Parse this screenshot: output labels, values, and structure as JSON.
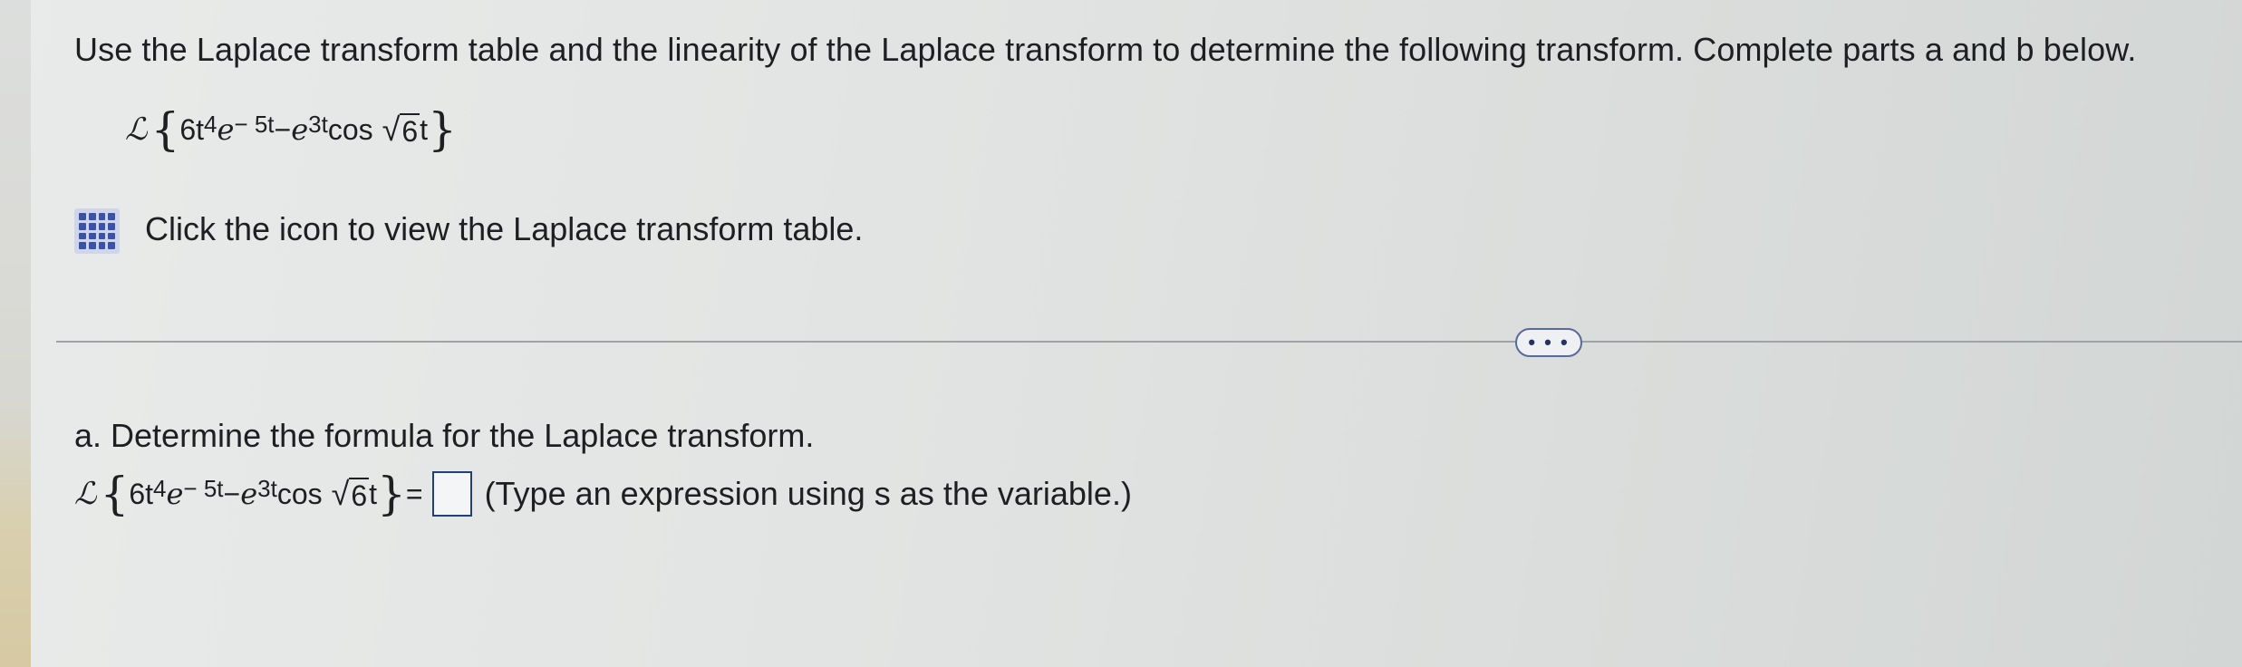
{
  "instructions": "Use the Laplace transform table and the linearity of the Laplace transform to determine the following transform. Complete parts a and b below.",
  "expression": {
    "operator": "ℒ",
    "open_brace": "{",
    "coef": "6t",
    "t_exp": "4",
    "e1": "e",
    "e1_exp": "− 5t",
    "minus": " − ",
    "e2": "e",
    "e2_exp": "3t",
    "cos": " cos ",
    "radical": "√",
    "radicand": "6",
    "t": " t",
    "close_brace": "}"
  },
  "table_link": "Click the icon to view the Laplace transform table.",
  "more_button": "• • •",
  "part_a": {
    "title": "a. Determine the formula for the Laplace transform.",
    "equals": " =",
    "hint": "(Type an expression using s as the variable.)"
  }
}
